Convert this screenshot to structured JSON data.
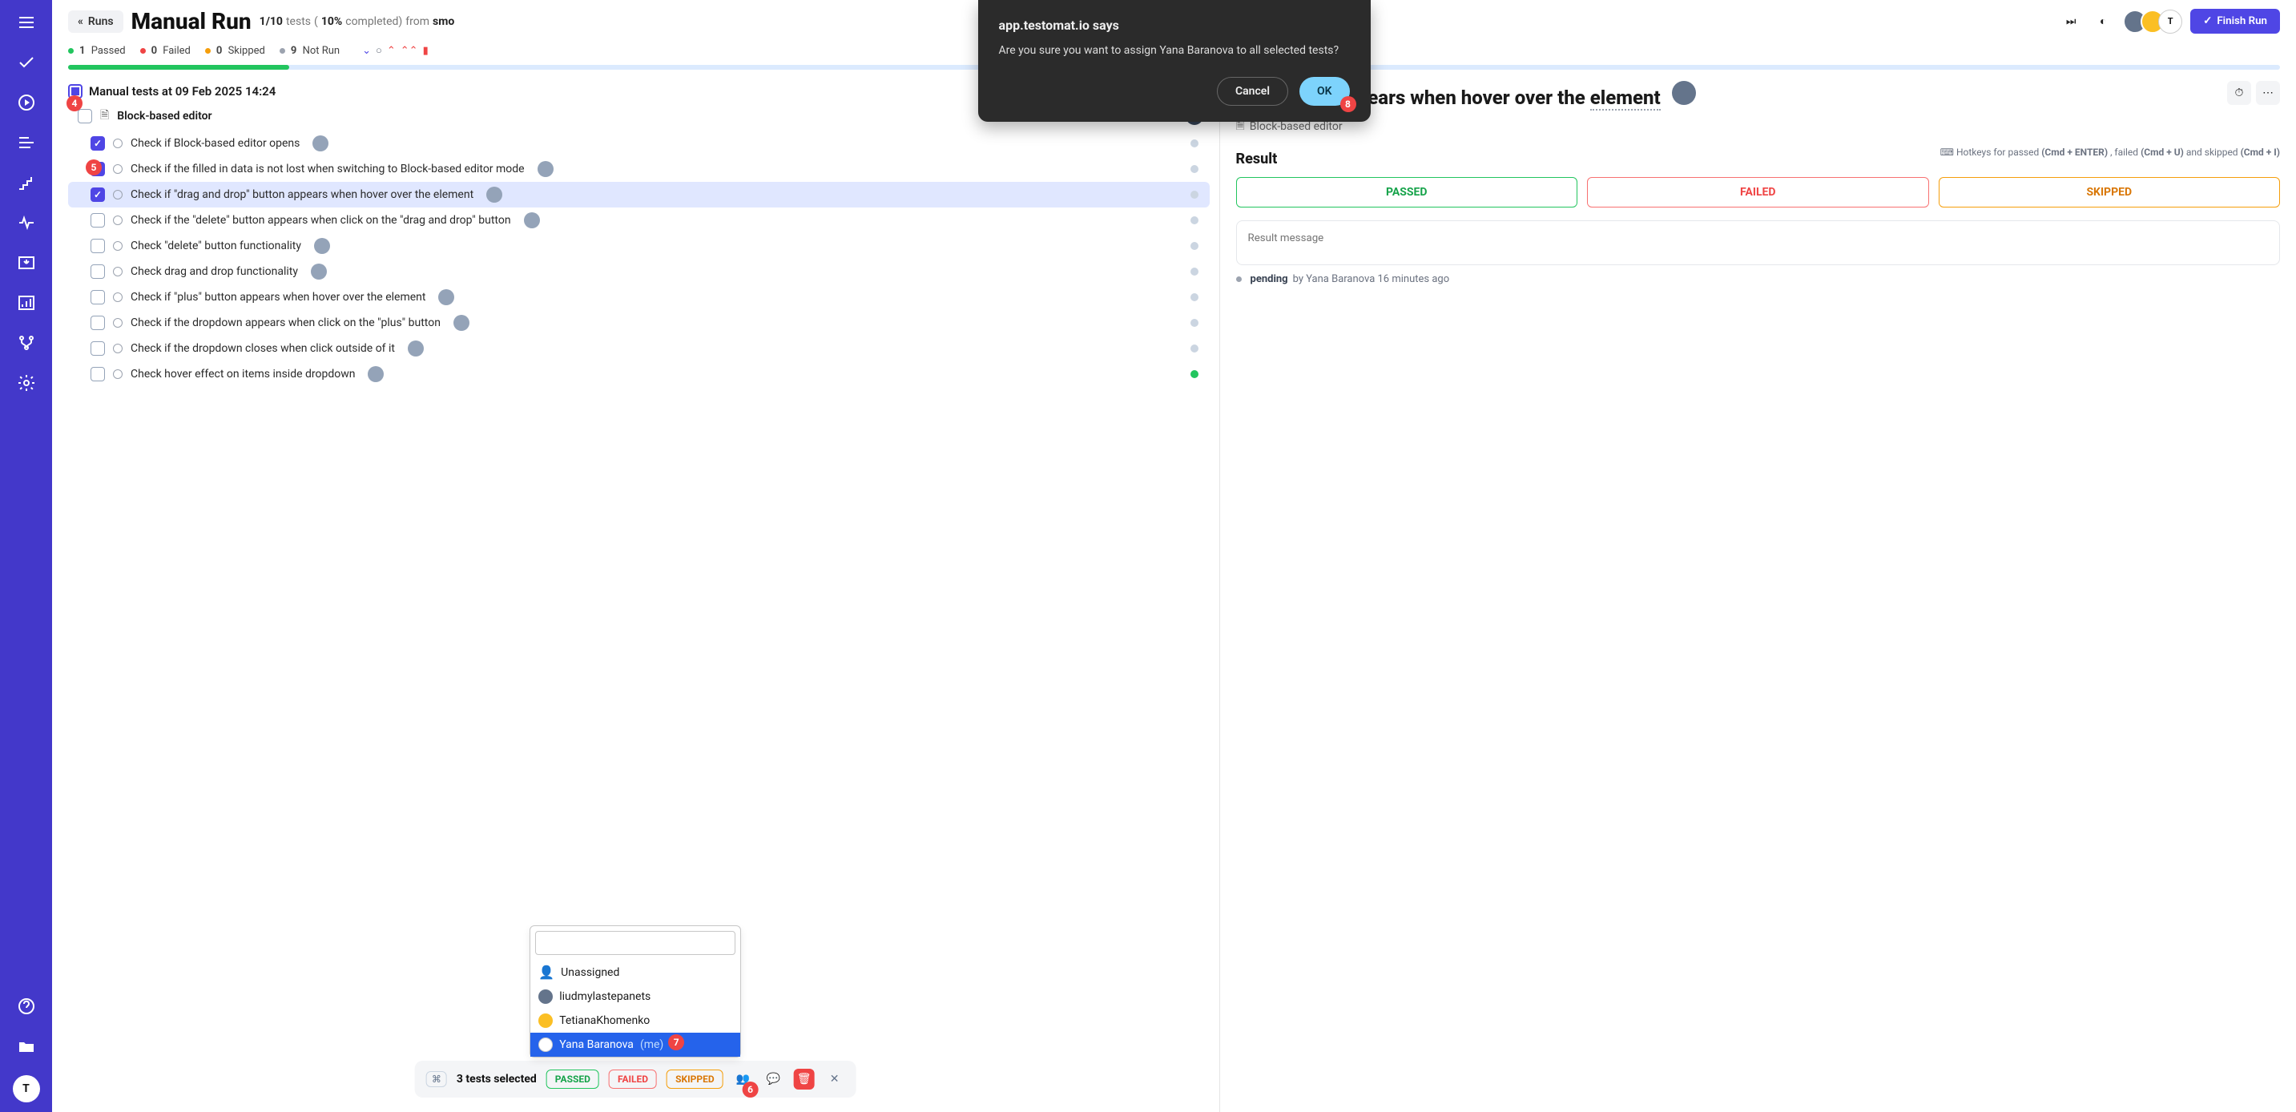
{
  "sidebar": {
    "logo": "T"
  },
  "header": {
    "runs_label": "Runs",
    "title": "Manual Run",
    "progress": "1/10",
    "tests_word": "tests",
    "percent": "10%",
    "completed_word": "completed)",
    "from_word": "from",
    "source": "smo",
    "finish_label": "Finish Run"
  },
  "stats": {
    "passed_n": "1",
    "passed_l": "Passed",
    "failed_n": "0",
    "failed_l": "Failed",
    "skipped_n": "0",
    "skipped_l": "Skipped",
    "notrun_n": "9",
    "notrun_l": "Not Run"
  },
  "run": {
    "name": "Manual tests at 09 Feb 2025 14:24"
  },
  "suite": {
    "name": "Block-based editor"
  },
  "tests": [
    {
      "name": "Check if Block-based editor opens",
      "checked": true,
      "selected": false,
      "status": "pending"
    },
    {
      "name": "Check if the filled in data is not lost when switching to Block-based editor mode",
      "checked": true,
      "selected": false,
      "status": "pending"
    },
    {
      "name": "Check if \"drag and drop\" button appears when hover over the element",
      "checked": true,
      "selected": true,
      "status": "pending"
    },
    {
      "name": "Check if the \"delete\" button appears when click on the \"drag and drop\" button",
      "checked": false,
      "selected": false,
      "status": "pending"
    },
    {
      "name": "Check \"delete\" button functionality",
      "checked": false,
      "selected": false,
      "status": "pending"
    },
    {
      "name": "Check drag and drop functionality",
      "checked": false,
      "selected": false,
      "status": "pending"
    },
    {
      "name": "Check if \"plus\" button appears when hover over the element",
      "checked": false,
      "selected": false,
      "status": "pending"
    },
    {
      "name": "Check if the dropdown appears when click on the \"plus\" button",
      "checked": false,
      "selected": false,
      "status": "pending"
    },
    {
      "name": "Check if the dropdown closes when click outside of it",
      "checked": false,
      "selected": false,
      "status": "pending"
    },
    {
      "name": "Check hover effect on items inside dropdown",
      "checked": false,
      "selected": false,
      "status": "pass"
    }
  ],
  "detail": {
    "title_suffix": "rop\" button appears when hover over the",
    "element_word": "element",
    "crumb": "Block-based editor",
    "result_h": "Result",
    "hotkeys_prefix": "Hotkeys for passed",
    "hk_pass": "(Cmd + ENTER)",
    "hk_mid": ", failed",
    "hk_fail": "(Cmd + U)",
    "hk_mid2": "and skipped",
    "hk_skip": "(Cmd + I)",
    "btn_pass": "PASSED",
    "btn_fail": "FAILED",
    "btn_skip": "SKIPPED",
    "msg_placeholder": "Result message",
    "pending_w": "pending",
    "pending_by": "by Yana Baranova 16 minutes ago"
  },
  "assign_popover": {
    "search_placeholder": "",
    "options": [
      {
        "label": "Unassigned",
        "me": ""
      },
      {
        "label": "liudmylastepanets",
        "me": ""
      },
      {
        "label": "TetianaKhomenko",
        "me": ""
      },
      {
        "label": "Yana Baranova",
        "me": "(me)"
      }
    ]
  },
  "bottom_bar": {
    "selected_text": "3 tests selected",
    "pass": "PASSED",
    "fail": "FAILED",
    "skip": "SKIPPED"
  },
  "dialog": {
    "title": "app.testomat.io says",
    "message": "Are you sure you want to assign Yana Baranova to all selected tests?",
    "cancel": "Cancel",
    "ok": "OK"
  },
  "annotations": {
    "a4": "4",
    "a5": "5",
    "a6": "6",
    "a7": "7",
    "a8": "8"
  },
  "colors": {
    "primary": "#4338ca",
    "green": "#22c55e",
    "red": "#ef4444",
    "amber": "#f59e0b"
  }
}
